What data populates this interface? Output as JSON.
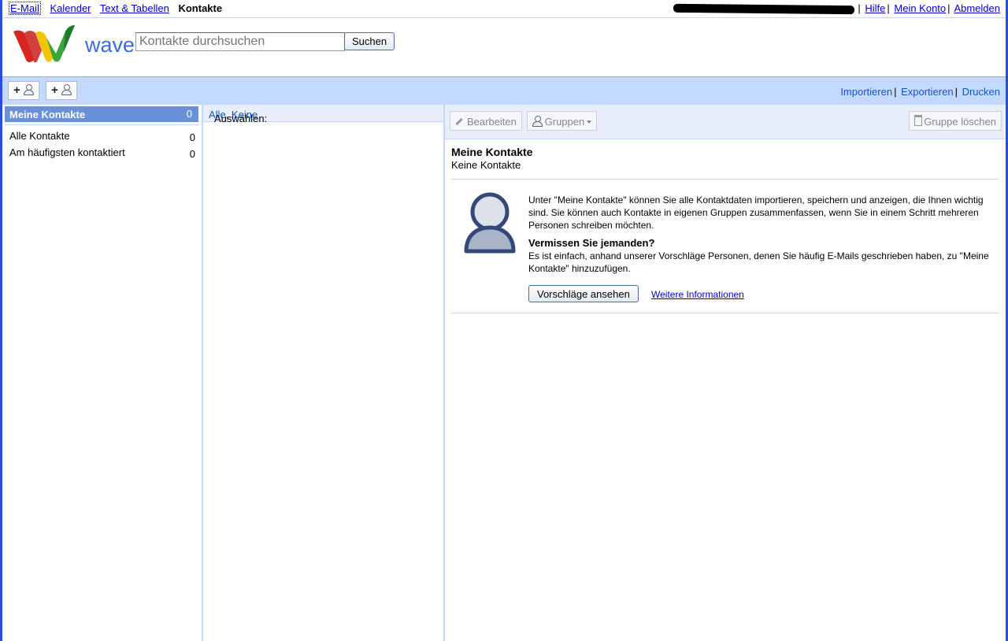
{
  "topnav": {
    "links": [
      "E-Mail",
      "Kalender",
      "Text & Tabellen"
    ],
    "current": "Kontakte",
    "account_suffix": "",
    "right_links": [
      "Hilfe",
      "Mein Konto",
      "Abmelden"
    ]
  },
  "header": {
    "logo_text": "wave",
    "search_placeholder": "Kontakte durchsuchen",
    "search_button": "Suchen"
  },
  "toolbar": {
    "actions": [
      "Importieren",
      "Exportieren",
      "Drucken"
    ]
  },
  "groups": {
    "selected": {
      "label": "Meine Kontakte",
      "count": "0"
    },
    "items": [
      {
        "label": "Alle Kontakte",
        "count": "0"
      },
      {
        "label": "Am häufigsten kontaktiert",
        "count": "0"
      }
    ]
  },
  "list": {
    "select_label": "Auswählen:",
    "select_all": "Alle",
    "select_none": "Keine"
  },
  "detail": {
    "toolbar": {
      "edit": "Bearbeiten",
      "groups": "Gruppen",
      "delete_group": "Gruppe löschen"
    },
    "title": "Meine Kontakte",
    "subtitle": "Keine Kontakte",
    "intro": "Unter \"Meine Kontakte\" können Sie alle Kontaktdaten importieren, speichern und anzeigen, die Ihnen wichtig sind. Sie können auch Kontakte in eigenen Gruppen zusammenfassen, wenn Sie in einem Schritt mehreren Personen schreiben möchten.",
    "missing_heading": "Vermissen Sie jemanden?",
    "missing_text": "Es ist einfach, anhand unserer Vorschläge Personen, denen Sie häufig E-Mails geschrieben haben, zu \"Meine Kontakte\" hinzuzufügen.",
    "suggest_button": "Vorschläge ansehen",
    "more_link": "Weitere Informationen"
  },
  "colors": {
    "band": "#c3d9ff",
    "selected_group": "#6b90da",
    "link": "#1155cc",
    "frame": "#2b4ed8"
  }
}
